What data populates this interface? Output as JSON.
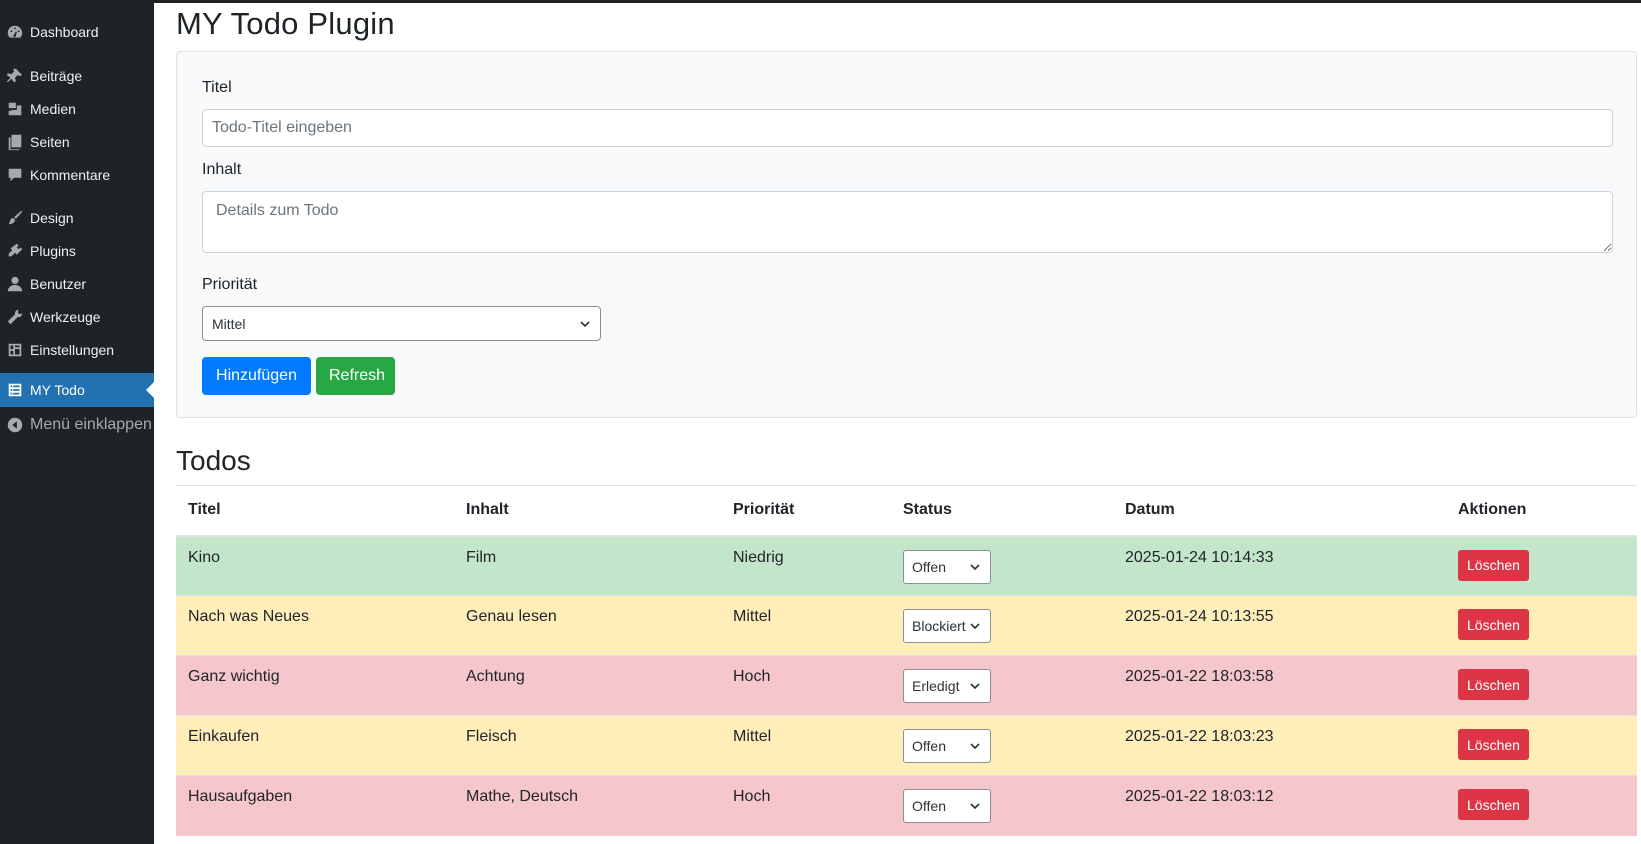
{
  "sidebar": {
    "items": [
      {
        "label": "Dashboard",
        "icon": "dashboard-icon"
      },
      {
        "label": "Beiträge",
        "icon": "pin-icon"
      },
      {
        "label": "Medien",
        "icon": "media-icon"
      },
      {
        "label": "Seiten",
        "icon": "pages-icon"
      },
      {
        "label": "Kommentare",
        "icon": "comments-icon"
      },
      {
        "label": "Design",
        "icon": "brush-icon"
      },
      {
        "label": "Plugins",
        "icon": "plugin-icon"
      },
      {
        "label": "Benutzer",
        "icon": "user-icon"
      },
      {
        "label": "Werkzeuge",
        "icon": "wrench-icon"
      },
      {
        "label": "Einstellungen",
        "icon": "settings-icon"
      },
      {
        "label": "MY Todo",
        "icon": "list-icon"
      }
    ],
    "collapse_label": "Menü einklappen",
    "active_color": "#2271b1"
  },
  "page": {
    "title": "MY Todo Plugin"
  },
  "form": {
    "title_label": "Titel",
    "title_placeholder": "Todo-Titel eingeben",
    "content_label": "Inhalt",
    "content_placeholder": "Details zum Todo",
    "priority_label": "Priorität",
    "priority_value": "Mittel",
    "add_button": "Hinzufügen",
    "refresh_button": "Refresh"
  },
  "todos": {
    "heading": "Todos",
    "columns": [
      "Titel",
      "Inhalt",
      "Priorität",
      "Status",
      "Datum",
      "Aktionen"
    ],
    "rows": [
      {
        "titel": "Kino",
        "inhalt": "Film",
        "prioritaet": "Niedrig",
        "status": "Offen",
        "datum": "2025-01-24 10:14:33",
        "action": "Löschen",
        "row_color": "#c3e6cb"
      },
      {
        "titel": "Nach was Neues",
        "inhalt": "Genau lesen",
        "prioritaet": "Mittel",
        "status": "Blockiert",
        "datum": "2025-01-24 10:13:55",
        "action": "Löschen",
        "row_color": "#ffeeba"
      },
      {
        "titel": "Ganz wichtig",
        "inhalt": "Achtung",
        "prioritaet": "Hoch",
        "status": "Erledigt",
        "datum": "2025-01-22 18:03:58",
        "action": "Löschen",
        "row_color": "#f5c6cb"
      },
      {
        "titel": "Einkaufen",
        "inhalt": "Fleisch",
        "prioritaet": "Mittel",
        "status": "Offen",
        "datum": "2025-01-22 18:03:23",
        "action": "Löschen",
        "row_color": "#ffeeba"
      },
      {
        "titel": "Hausaufgaben",
        "inhalt": "Mathe, Deutsch",
        "prioritaet": "Hoch",
        "status": "Offen",
        "datum": "2025-01-22 18:03:12",
        "action": "Löschen",
        "row_color": "#f5c6cb"
      }
    ]
  },
  "colors": {
    "primary": "#007bff",
    "success": "#28a745",
    "danger": "#dc3545"
  }
}
